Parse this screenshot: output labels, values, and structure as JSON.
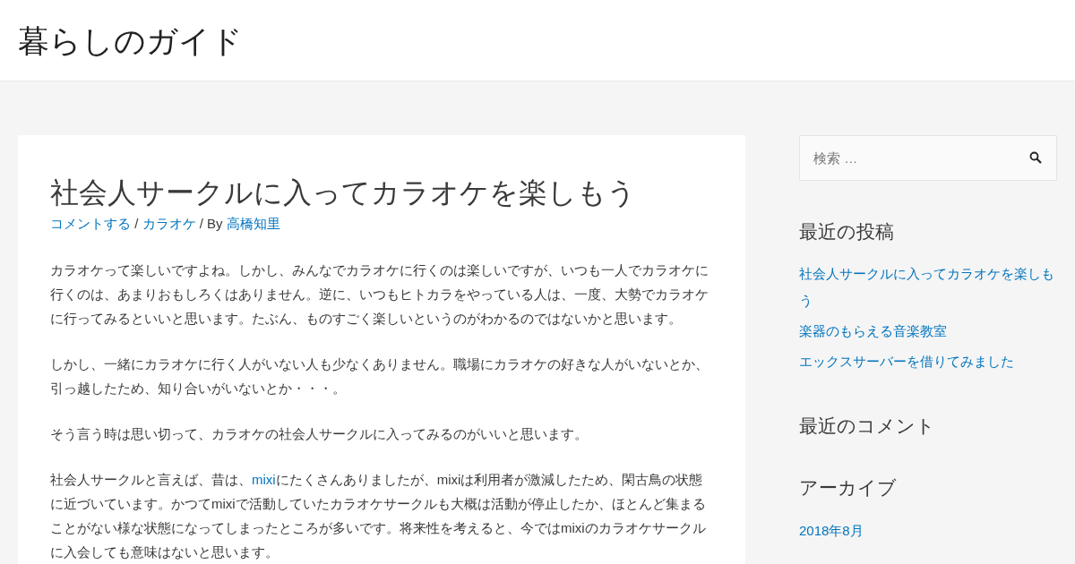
{
  "site_title": "暮らしのガイド",
  "article": {
    "title": "社会人サークルに入ってカラオケを楽しもう",
    "meta": [
      {
        "text": "コメントする",
        "link": true
      },
      {
        "text": " / ",
        "link": false
      },
      {
        "text": "カラオケ",
        "link": true
      },
      {
        "text": " / By ",
        "link": false
      },
      {
        "text": "高橋知里",
        "link": true
      }
    ],
    "paragraphs": [
      [
        {
          "text": "カラオケって楽しいですよね。しかし、みんなでカラオケに行くのは楽しいですが、いつも一人でカラオケに行くのは、あまりおもしろくはありません。逆に、いつもヒトカラをやっている人は、一度、大勢でカラオケに行ってみるといいと思います。たぶん、ものすごく楽しいというのがわかるのではないかと思います。",
          "link": false
        }
      ],
      [
        {
          "text": "しかし、一緒にカラオケに行く人がいない人も少なくありません。職場にカラオケの好きな人がいないとか、引っ越したため、知り合いがいないとか・・・。",
          "link": false
        }
      ],
      [
        {
          "text": "そう言う時は思い切って、カラオケの社会人サークルに入ってみるのがいいと思います。",
          "link": false
        }
      ],
      [
        {
          "text": "社会人サークルと言えば、昔は、",
          "link": false
        },
        {
          "text": "mixi",
          "link": true
        },
        {
          "text": "にたくさんありましたが、mixiは利用者が激減したため、閑古鳥の状態に近づいています。かつてmixiで活動していたカラオケサークルも大概は活動が停止したか、ほとんど集まることがない様な状態になってしまったところが多いです。将来性を考えると、今ではmixiのカラオケサークルに入会しても意味はないと思います。",
          "link": false
        }
      ]
    ]
  },
  "sidebar": {
    "search": {
      "placeholder": "検索 …"
    },
    "widgets": [
      {
        "title": "最近の投稿",
        "links": [
          "社会人サークルに入ってカラオケを楽しもう",
          "楽器のもらえる音楽教室",
          "エックスサーバーを借りてみました"
        ]
      },
      {
        "title": "最近のコメント"
      },
      {
        "title": "アーカイブ",
        "links": [
          "2018年8月"
        ]
      }
    ]
  }
}
